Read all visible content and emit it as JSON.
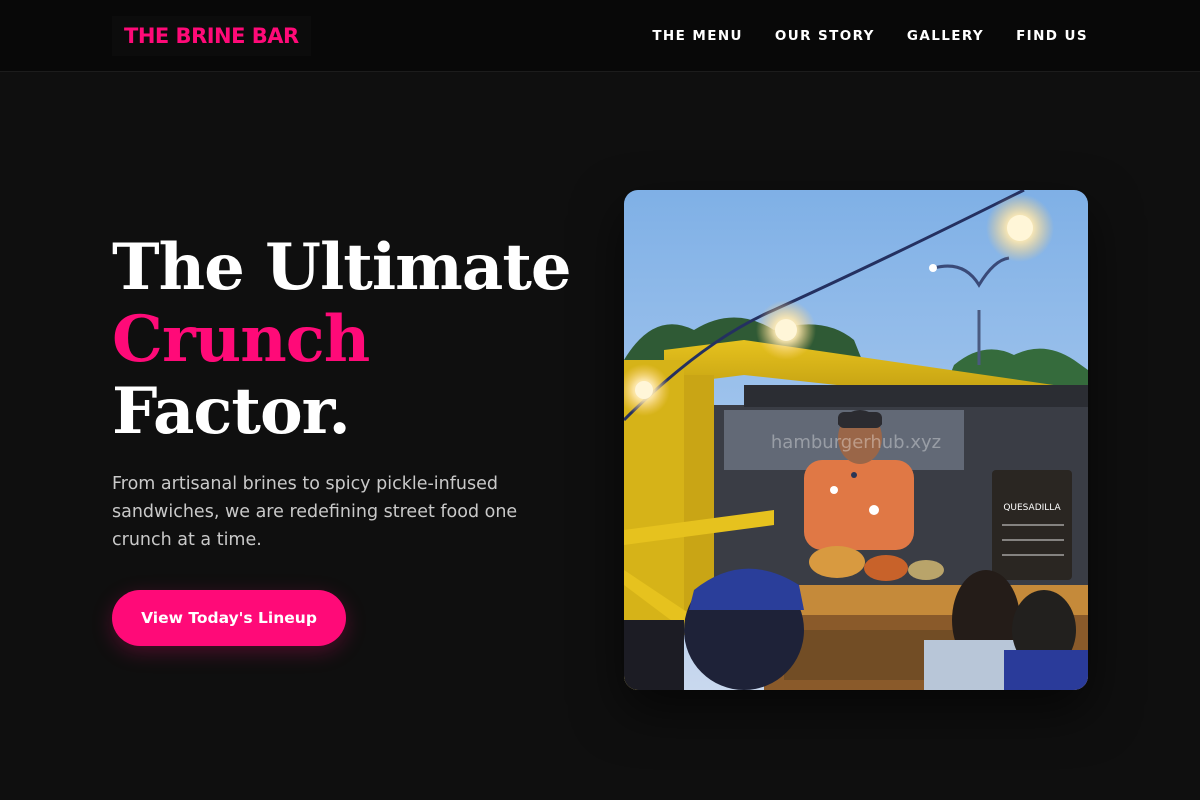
{
  "nav": {
    "logo": "THE BRINE BAR",
    "links": [
      "THE MENU",
      "OUR STORY",
      "GALLERY",
      "FIND US"
    ]
  },
  "hero": {
    "headline_line1": "The Ultimate",
    "headline_line2": "Crunch",
    "headline_line3": "Factor.",
    "description": "From artisanal brines to spicy pickle-infused sandwiches, we are redefining street food one crunch at a time.",
    "cta_label": "View Today's Lineup",
    "image": {
      "alt": "Food truck vendor serving customers at night market",
      "watermark": "hamburgerhub.xyz",
      "chalkboard_heading": "QUESADILLA"
    }
  },
  "colors": {
    "accent": "#ff0a78",
    "background": "#0f0f0f",
    "nav_background": "#080808"
  }
}
